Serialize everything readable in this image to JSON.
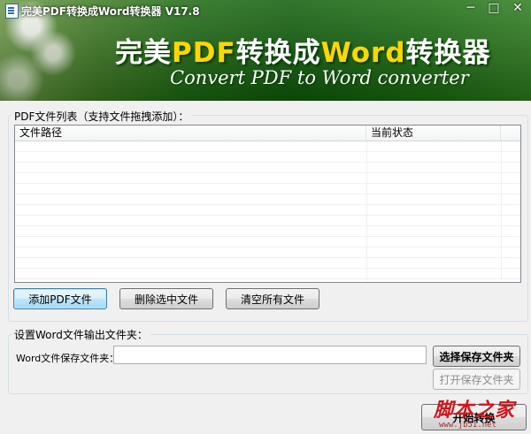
{
  "window": {
    "title": "完美PDF转换成Word转换器 V17.8",
    "controls": {
      "minimize": "─",
      "maximize": "□",
      "close": "✕"
    }
  },
  "banner": {
    "title_part1": "完美",
    "title_pdf": "PDF",
    "title_part2": "转换成",
    "title_word": "Word",
    "title_part3": "转换器",
    "subtitle": "Convert PDF  to Word converter"
  },
  "file_list": {
    "legend": "PDF文件列表（支持文件拖拽添加）：",
    "columns": [
      "文件路径",
      "当前状态"
    ],
    "rows": []
  },
  "buttons": {
    "add_pdf": "添加PDF文件",
    "delete_selected": "删除选中文件",
    "clear_all": "清空所有文件"
  },
  "output": {
    "legend": "设置Word文件输出文件夹：",
    "folder_label": "Word文件保存文件夹：",
    "folder_value": "",
    "choose_folder": "选择保存文件夹",
    "open_folder": "打开保存文件夹"
  },
  "start_button": "开始转换",
  "watermark": {
    "text": "脚本之家",
    "url": "www.jb51.net"
  },
  "colors": {
    "banner_green": "#1d6a12",
    "title_yellow": "#ffd700",
    "watermark_red": "#d0161c"
  },
  "icons": [
    "app-icon",
    "minimize-icon",
    "maximize-icon",
    "close-icon"
  ]
}
